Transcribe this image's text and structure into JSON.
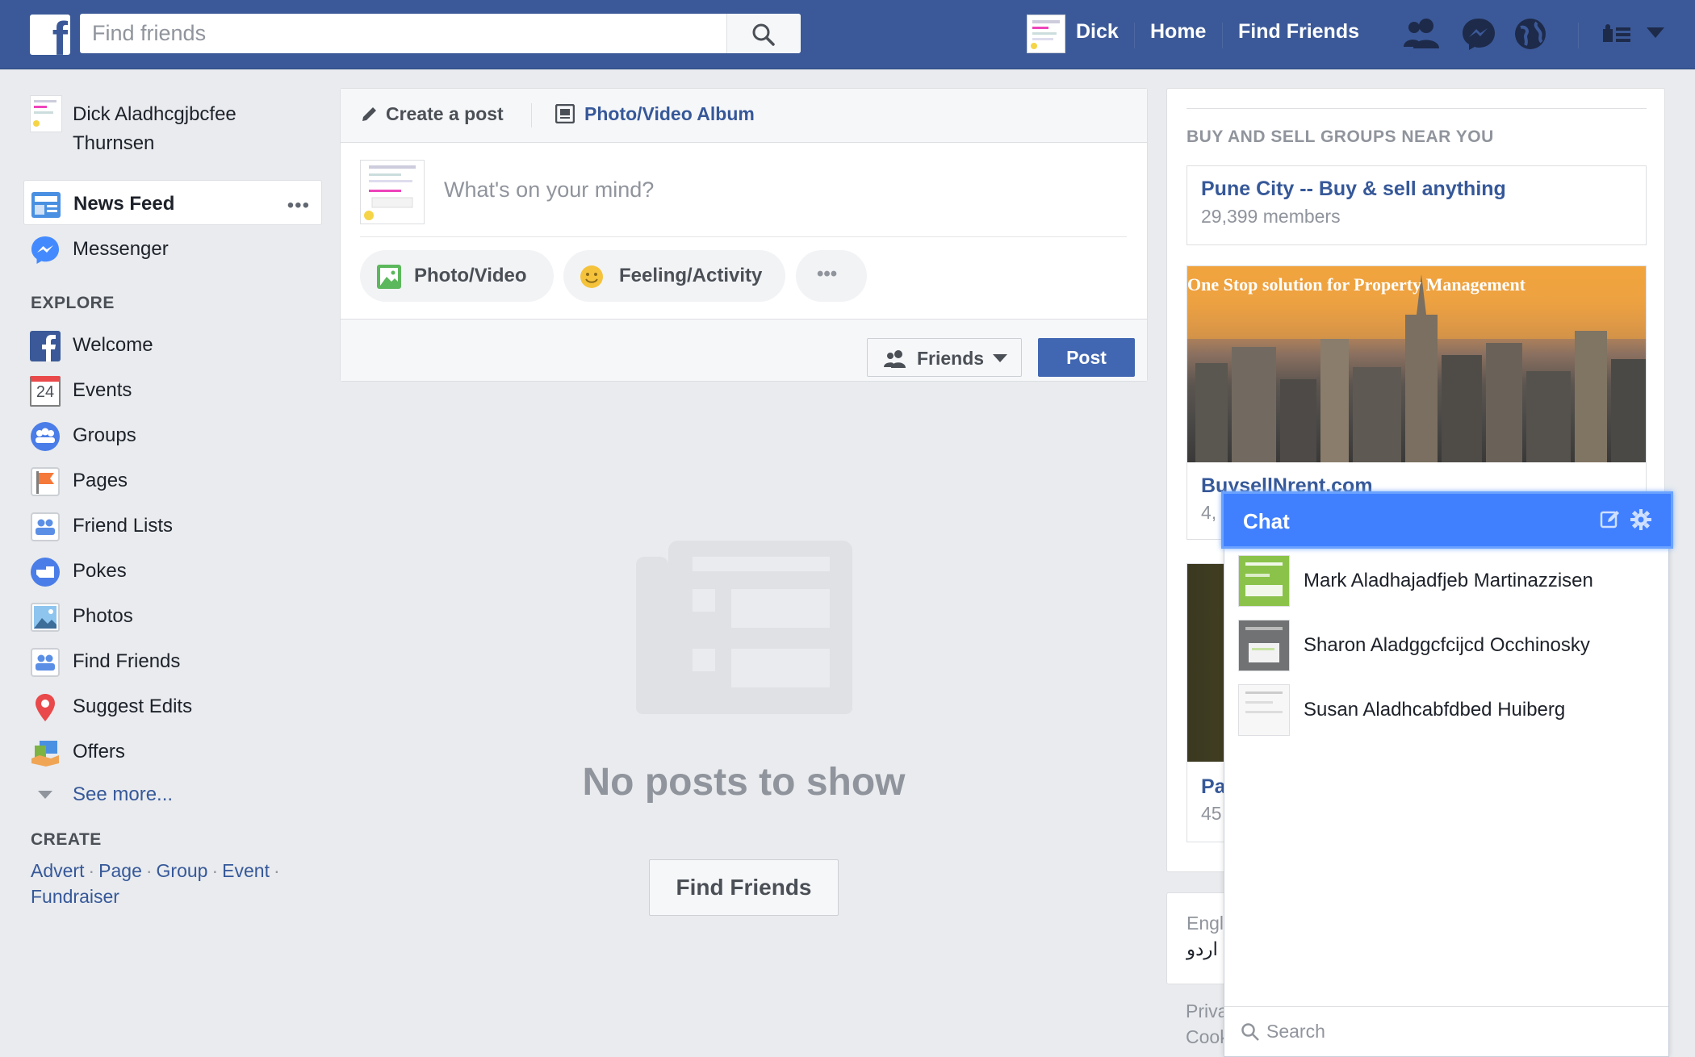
{
  "topbar": {
    "logo": "f",
    "search_placeholder": "Find friends",
    "user_name": "Dick",
    "home": "Home",
    "find_friends": "Find Friends",
    "brand_color": "#3b5998"
  },
  "sidebar": {
    "profile_name": "Dick Aladhcgjbcfee Thurnsen",
    "main_items": [
      {
        "label": "News Feed",
        "icon": "news-feed-icon",
        "active": true
      },
      {
        "label": "Messenger",
        "icon": "messenger-icon"
      }
    ],
    "more_dots": "•••",
    "explore_title": "EXPLORE",
    "explore_items": [
      {
        "label": "Welcome",
        "icon": "facebook-icon"
      },
      {
        "label": "Events",
        "icon": "calendar-icon",
        "icon_text": "24"
      },
      {
        "label": "Groups",
        "icon": "groups-icon"
      },
      {
        "label": "Pages",
        "icon": "flag-icon"
      },
      {
        "label": "Friend Lists",
        "icon": "friend-list-icon"
      },
      {
        "label": "Pokes",
        "icon": "poke-icon"
      },
      {
        "label": "Photos",
        "icon": "photos-icon"
      },
      {
        "label": "Find Friends",
        "icon": "find-friends-icon"
      },
      {
        "label": "Suggest Edits",
        "icon": "map-pin-icon"
      },
      {
        "label": "Offers",
        "icon": "offers-icon"
      }
    ],
    "see_more": "See more...",
    "create_title": "CREATE",
    "create_links": [
      "Advert",
      "Page",
      "Group",
      "Event",
      "Fundraiser"
    ],
    "separator": "·"
  },
  "composer": {
    "tab_create": "Create a post",
    "tab_album": "Photo/Video Album",
    "placeholder": "What's on your mind?",
    "photo_video": "Photo/Video",
    "feeling": "Feeling/Activity",
    "more": "•••",
    "audience": "Friends",
    "post": "Post"
  },
  "feed": {
    "empty_text": "No posts to show",
    "find_friends_button": "Find Friends"
  },
  "right": {
    "groups_title": "BUY AND SELL GROUPS NEAR YOU",
    "group_name": "Pune City -- Buy & sell anything",
    "group_members": "29,399 members",
    "ad_tagline": "One Stop solution for Property Management",
    "ad_name": "BuysellNrent.com",
    "ad_sub": "4,",
    "ad2_name": "Pa",
    "ad2_sub": "45",
    "lang_1": "Engl",
    "lang_2": "اردو",
    "footer_1": "Priva",
    "footer_2": "Cook"
  },
  "chat": {
    "title": "Chat",
    "contacts": [
      {
        "name": "Mark Aladhajadfjeb Martinazzisen",
        "avatar_color": "#7cb342"
      },
      {
        "name": "Sharon Aladggcfcijcd Occhinosky",
        "avatar_color": "#6d6f72"
      },
      {
        "name": "Susan Aladhcabfdbed Huiberg",
        "avatar_color": "#f4f4f4"
      }
    ],
    "search_placeholder": "Search",
    "header_color": "#4080ff"
  }
}
